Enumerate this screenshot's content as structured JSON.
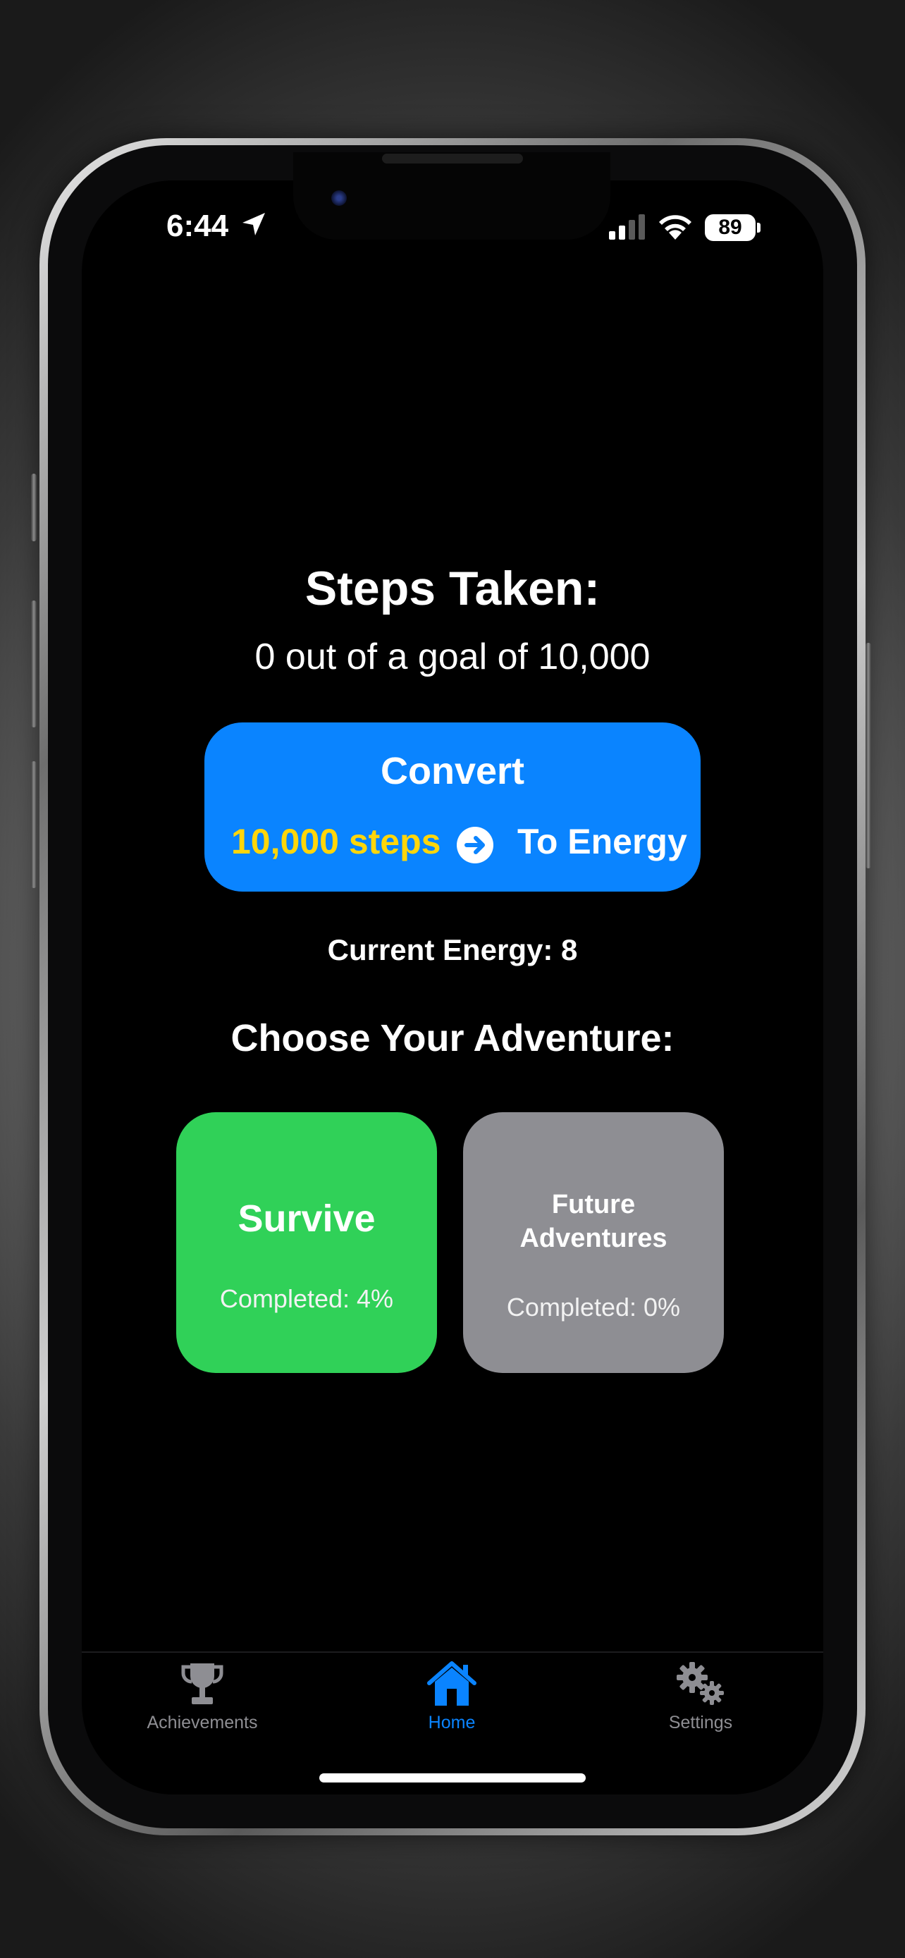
{
  "status_bar": {
    "time": "6:44",
    "battery": "89"
  },
  "main": {
    "title": "Steps Taken:",
    "subtitle": "0 out of a goal of 10,000",
    "convert": {
      "label": "Convert",
      "steps": "10,000 steps",
      "target": "To Energy"
    },
    "energy": "Current Energy: 8",
    "choose_heading": "Choose Your Adventure:",
    "cards": [
      {
        "title": "Survive",
        "completed": "Completed: 4%",
        "color": "#30d158"
      },
      {
        "title_line1": "Future",
        "title_line2": "Adventures",
        "completed": "Completed: 0%",
        "color": "#8e8e93"
      }
    ]
  },
  "tabs": [
    {
      "label": "Achievements",
      "icon": "trophy-icon",
      "active": false
    },
    {
      "label": "Home",
      "icon": "house-icon",
      "active": true
    },
    {
      "label": "Settings",
      "icon": "gears-icon",
      "active": false
    }
  ],
  "colors": {
    "accent": "#0a84ff",
    "steps_highlight": "#ffd60a",
    "inactive_tab": "#8e8e93"
  }
}
